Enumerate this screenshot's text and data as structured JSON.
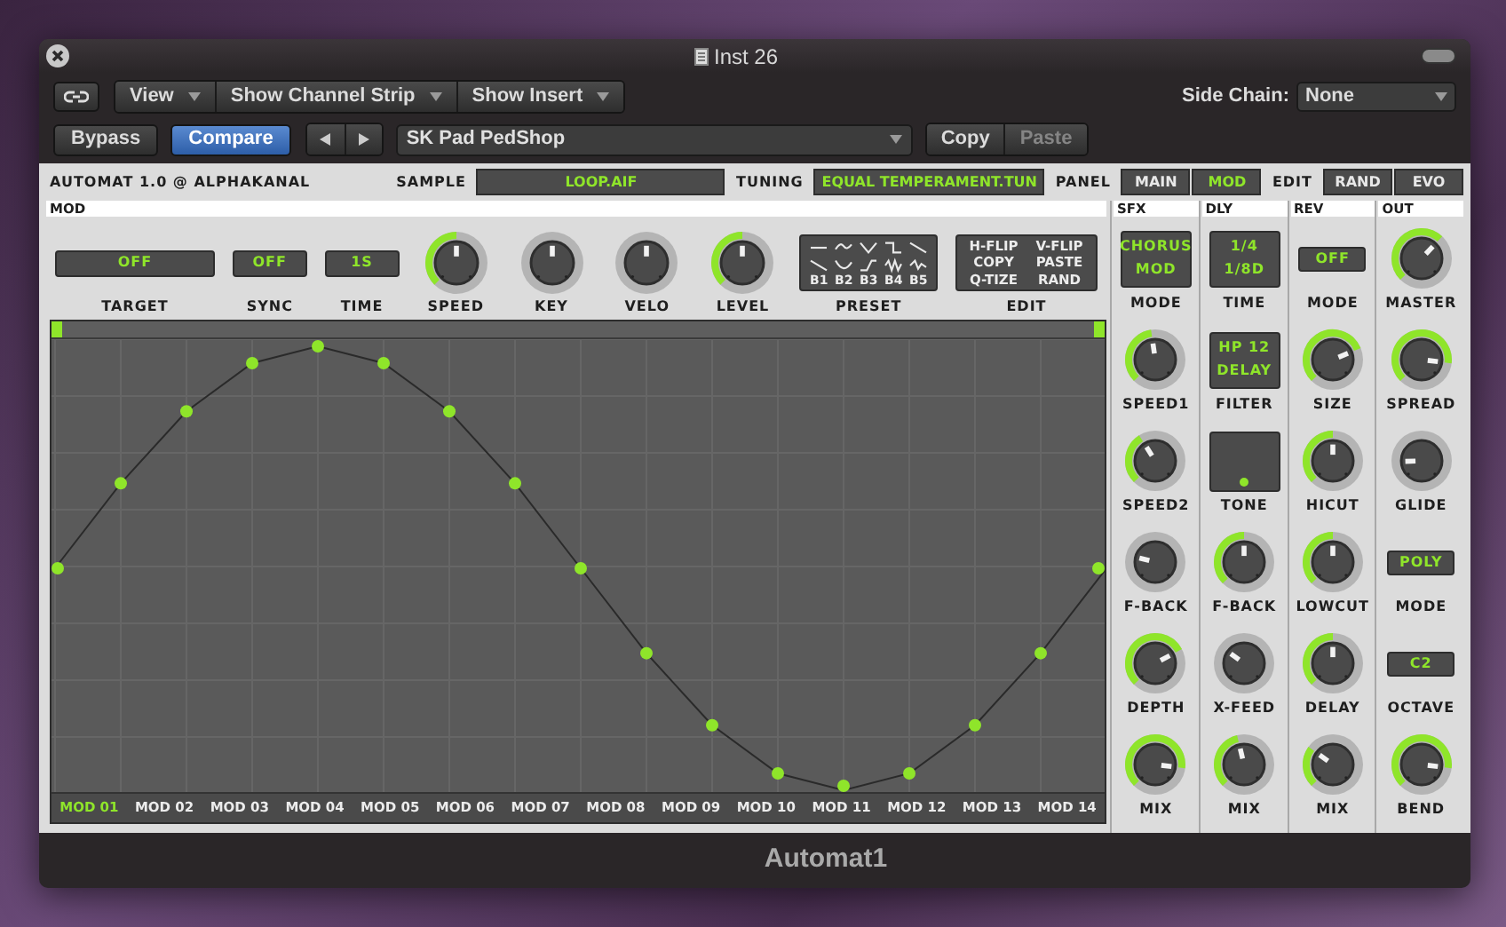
{
  "window": {
    "title": "Inst 26",
    "footer": "Automat1"
  },
  "toolbar": {
    "view_menus": [
      "View",
      "Show Channel Strip",
      "Show Insert"
    ],
    "side_chain": {
      "label": "Side Chain:",
      "value": "None"
    },
    "bypass": "Bypass",
    "compare": {
      "label": "Compare",
      "selected": true
    },
    "preset": "SK Pad PedShop",
    "copy": "Copy",
    "paste": {
      "label": "Paste",
      "disabled": true
    }
  },
  "header": {
    "title": "AUTOMAT 1.0 @ ALPHAKANAL",
    "sample": {
      "label": "SAMPLE",
      "value": "LOOP.AIF"
    },
    "tuning": {
      "label": "TUNING",
      "value": "EQUAL TEMPERAMENT.TUN"
    },
    "panel": {
      "label": "PANEL",
      "options": [
        {
          "label": "MAIN",
          "selected": false
        },
        {
          "label": "MOD",
          "selected": true
        }
      ]
    },
    "edit": {
      "label": "EDIT",
      "buttons": [
        "RAND",
        "EVO"
      ]
    }
  },
  "mod": {
    "title": "MOD",
    "controls": [
      {
        "kind": "selector",
        "label": "TARGET",
        "lines": [
          "OFF"
        ]
      },
      {
        "kind": "box",
        "label": "SYNC",
        "lines": [
          "OFF"
        ]
      },
      {
        "kind": "box",
        "label": "TIME",
        "lines": [
          "1S"
        ]
      },
      {
        "kind": "knob",
        "label": "SPEED",
        "level": 0.5,
        "lit": true
      },
      {
        "kind": "knob",
        "label": "KEY",
        "level": 0.5,
        "lit": false
      },
      {
        "kind": "knob",
        "label": "VELO",
        "level": 0.5,
        "lit": false
      },
      {
        "kind": "knob",
        "label": "LEVEL",
        "level": 0.5,
        "lit": true
      },
      {
        "kind": "preset",
        "label": "PRESET",
        "lines": [
          "B1",
          "B2",
          "B3",
          "B4",
          "B5"
        ]
      },
      {
        "kind": "grid",
        "label": "EDIT",
        "lines": [
          "H-FLIP",
          "V-FLIP",
          "COPY",
          "PASTE",
          "Q-TIZE",
          "RAND"
        ]
      }
    ],
    "tabs": [
      {
        "label": "MOD 01",
        "selected": true
      },
      {
        "label": "MOD 02",
        "selected": false
      },
      {
        "label": "MOD 03",
        "selected": false
      },
      {
        "label": "MOD 04",
        "selected": false
      },
      {
        "label": "MOD 05",
        "selected": false
      },
      {
        "label": "MOD 06",
        "selected": false
      },
      {
        "label": "MOD 07",
        "selected": false
      },
      {
        "label": "MOD 08",
        "selected": false
      },
      {
        "label": "MOD 09",
        "selected": false
      },
      {
        "label": "MOD 10",
        "selected": false
      },
      {
        "label": "MOD 11",
        "selected": false
      },
      {
        "label": "MOD 12",
        "selected": false
      },
      {
        "label": "MOD 13",
        "selected": false
      },
      {
        "label": "MOD 14",
        "selected": false
      }
    ]
  },
  "columns": [
    {
      "title": "SFX",
      "controls": [
        {
          "kind": "box",
          "label": "MODE",
          "lines": [
            "CHORUS",
            "MOD"
          ]
        },
        {
          "kind": "knob",
          "label": "SPEED1",
          "level": 0.47,
          "lit": true
        },
        {
          "kind": "knob",
          "label": "SPEED2",
          "level": 0.38,
          "lit": true
        },
        {
          "kind": "knob",
          "label": "F-BACK",
          "level": 0.22,
          "lit": false
        },
        {
          "kind": "knob",
          "label": "DEPTH",
          "level": 0.73,
          "lit": true
        },
        {
          "kind": "knob",
          "label": "MIX",
          "level": 0.86,
          "lit": true
        }
      ]
    },
    {
      "title": "DLY",
      "controls": [
        {
          "kind": "box",
          "label": "TIME",
          "lines": [
            "1/4",
            "1/8D"
          ]
        },
        {
          "kind": "box",
          "label": "FILTER",
          "lines": [
            "HP 12",
            "DELAY"
          ]
        },
        {
          "kind": "pad",
          "label": "TONE"
        },
        {
          "kind": "knob",
          "label": "F-BACK",
          "level": 0.5,
          "lit": true
        },
        {
          "kind": "knob",
          "label": "X-FEED",
          "level": 0.3,
          "lit": false
        },
        {
          "kind": "knob",
          "label": "MIX",
          "level": 0.45,
          "lit": true
        }
      ]
    },
    {
      "title": "REV",
      "controls": [
        {
          "kind": "box",
          "label": "MODE",
          "lines": [
            "OFF"
          ]
        },
        {
          "kind": "knob",
          "label": "SIZE",
          "level": 0.75,
          "lit": true
        },
        {
          "kind": "knob",
          "label": "HICUT",
          "level": 0.5,
          "lit": true
        },
        {
          "kind": "knob",
          "label": "LOWCUT",
          "level": 0.5,
          "lit": true
        },
        {
          "kind": "knob",
          "label": "DELAY",
          "level": 0.5,
          "lit": true
        },
        {
          "kind": "knob",
          "label": "MIX",
          "level": 0.3,
          "lit": true
        }
      ]
    },
    {
      "title": "OUT",
      "controls": [
        {
          "kind": "knob",
          "label": "MASTER",
          "level": 0.66,
          "lit": true
        },
        {
          "kind": "knob",
          "label": "SPREAD",
          "level": 0.86,
          "lit": true
        },
        {
          "kind": "knob",
          "label": "GLIDE",
          "level": 0.16,
          "lit": false
        },
        {
          "kind": "box",
          "label": "MODE",
          "lines": [
            "POLY"
          ]
        },
        {
          "kind": "box",
          "label": "OCTAVE",
          "lines": [
            "C2"
          ]
        },
        {
          "kind": "knob",
          "label": "BEND",
          "level": 0.86,
          "lit": true
        }
      ]
    }
  ]
}
